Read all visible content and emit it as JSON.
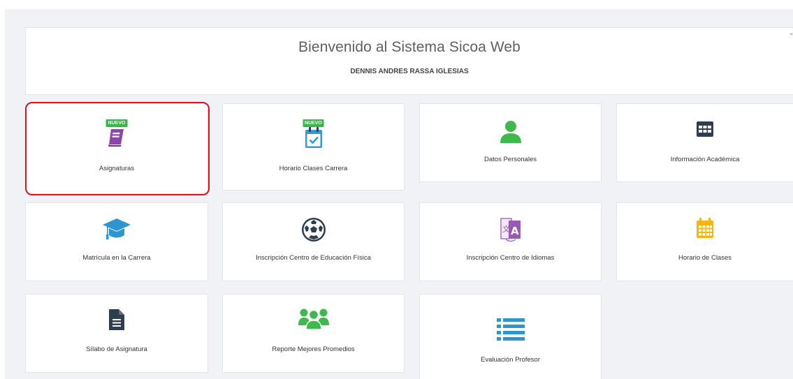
{
  "welcome": {
    "title": "Bienvenido al Sistema Sicoa Web",
    "user_name": "DENNIS ANDRES RASSA IGLESIAS",
    "corner_glyph": "«"
  },
  "tiles": {
    "asignaturas": {
      "label": "Asignaturas",
      "badge": "NUEVO",
      "icon": "book-icon",
      "color": "#8e44ad"
    },
    "horario_carrera": {
      "label": "Horario Clases Carrera",
      "badge": "NUEVO",
      "icon": "calendar-check-icon",
      "color": "#3498db"
    },
    "datos_personales": {
      "label": "Datos Personales",
      "icon": "user-icon",
      "color": "#3fb84e"
    },
    "info_academica": {
      "label": "Información Académica",
      "icon": "table-icon",
      "color": "#2c3e50"
    },
    "matricula": {
      "label": "Matrícula en la Carrera",
      "icon": "graduation-cap-icon",
      "color": "#2e95d3"
    },
    "educacion_fisica": {
      "label": "Inscripción Centro de Educación Física",
      "icon": "soccer-ball-icon",
      "color": "#2c3e50"
    },
    "idiomas": {
      "label": "Inscripción Centro de Idiomas",
      "icon": "translate-icon",
      "color": "#9b59b6"
    },
    "horario_clases": {
      "label": "Horario de Clases",
      "icon": "calendar-icon",
      "color": "#f5b70f"
    },
    "silabo": {
      "label": "Sílabo de Asignatura",
      "icon": "document-icon",
      "color": "#2c3e50"
    },
    "mejores_promedios": {
      "label": "Reporte Mejores Promedios",
      "icon": "group-icon",
      "color": "#3fb84e"
    },
    "evaluacion_profesor": {
      "label": "Evaluación Profesor",
      "icon": "list-icon",
      "color": "#2e95d3"
    }
  }
}
